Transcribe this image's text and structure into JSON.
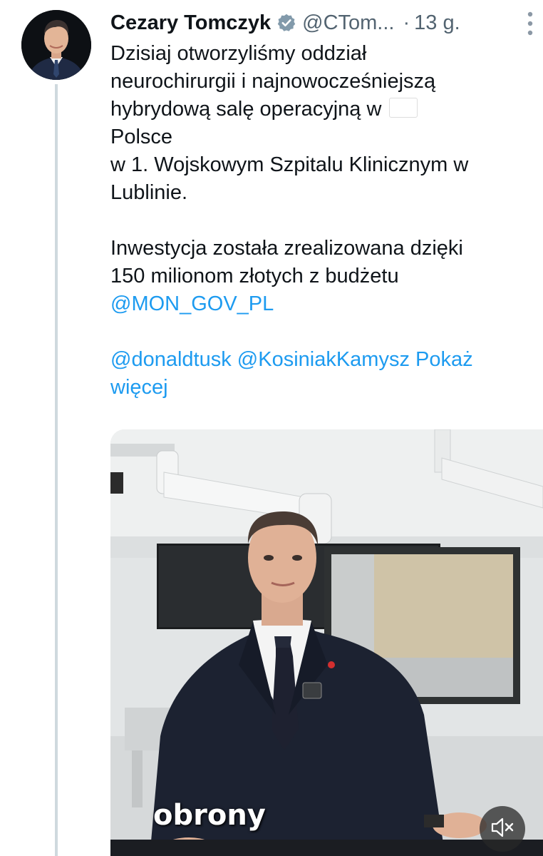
{
  "tweet": {
    "author_name": "Cezary Tomczyk",
    "handle": "@CTom...",
    "separator": "·",
    "time": "13 g.",
    "text_lines": [
      "Dzisiaj otworzyliśmy oddział",
      "neurochirurgii i najnowocześniejszą",
      "hybrydową salę operacyjną w",
      "Polsce",
      "w 1. Wojskowym Szpitalu Klinicznym w",
      "Lublinie.",
      "Inwestycja została zrealizowana dzięki",
      "150 milionom złotych z budżetu"
    ],
    "mention_mon": "@MON_GOV_PL",
    "mention_tusk": "@donaldtusk",
    "mention_kosiniak": "@KosiniakKamysz",
    "show_more": "Pokaż",
    "show_more_2": "więcej",
    "flag_icon": "poland-flag-icon"
  },
  "video": {
    "caption": "obrony",
    "mute_icon": "speaker-muted-icon"
  },
  "colors": {
    "link": "#1d9bf0",
    "text": "#0f1419",
    "secondary": "#536471",
    "thread_line": "#cfd9de"
  }
}
